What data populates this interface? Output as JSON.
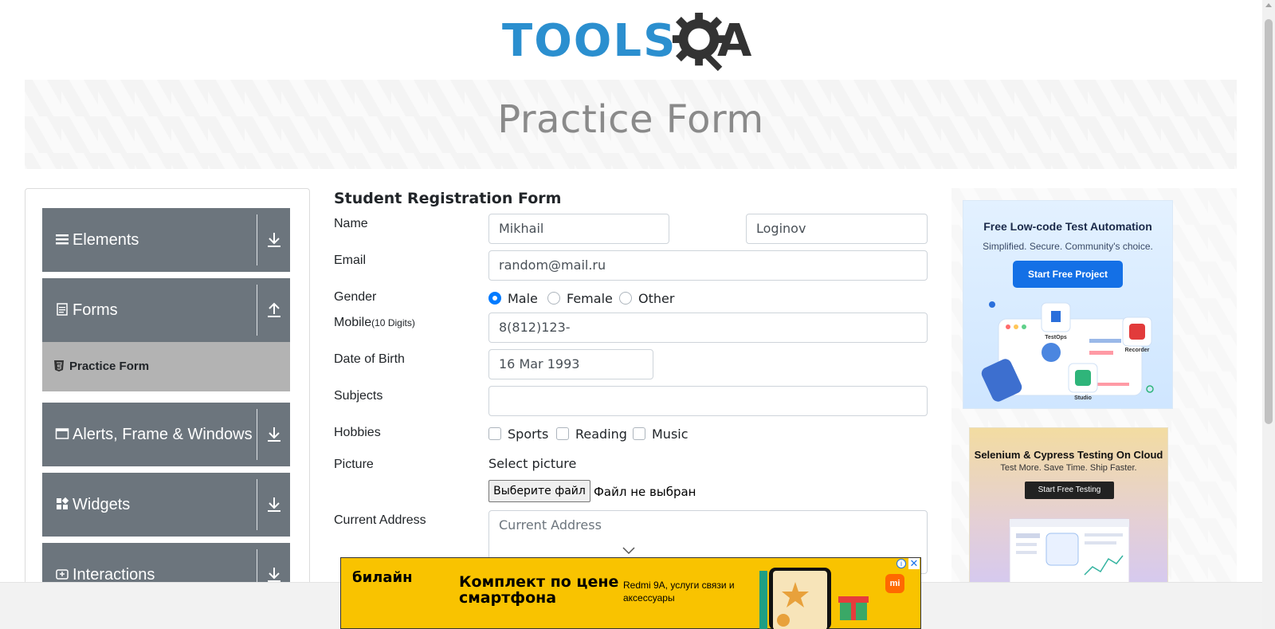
{
  "header": {
    "logo_text_tools": "TOOLS",
    "logo_text_a": "A",
    "brand_colors": {
      "tools": "#2b8fcf",
      "qa": "#333333"
    }
  },
  "banner": {
    "title": "Practice Form"
  },
  "sidebar": {
    "groups": [
      {
        "label": "Elements",
        "icon": "hamburger-icon",
        "expanded": false
      },
      {
        "label": "Forms",
        "icon": "form-icon",
        "expanded": true
      },
      {
        "label": "Alerts, Frame & Windows",
        "icon": "window-icon",
        "expanded": false
      },
      {
        "label": "Widgets",
        "icon": "widgets-icon",
        "expanded": false
      },
      {
        "label": "Interactions",
        "icon": "interactions-icon",
        "expanded": false
      }
    ],
    "active_item": {
      "label": "Practice Form",
      "icon": "html-icon"
    }
  },
  "form": {
    "title": "Student Registration Form",
    "name_label": "Name",
    "first_name": "Mikhail",
    "last_name": "Loginov",
    "email_label": "Email",
    "email": "random@mail.ru",
    "gender_label": "Gender",
    "gender_options": [
      "Male",
      "Female",
      "Other"
    ],
    "gender_selected": "Male",
    "mobile_label": "Mobile",
    "mobile_hint": "(10 Digits)",
    "mobile": "8(812)123-",
    "dob_label": "Date of Birth",
    "dob": "16 Mar 1993",
    "subjects_label": "Subjects",
    "subjects": "",
    "hobbies_label": "Hobbies",
    "hobbies": [
      "Sports",
      "Reading",
      "Music"
    ],
    "picture_label": "Picture",
    "select_picture": "Select picture",
    "file_button": "Выберите файл",
    "file_status": "Файл не выбран",
    "address_label": "Current Address",
    "address_placeholder": "Current Address"
  },
  "ads": {
    "ad1": {
      "title": "Free Low-code Test Automation",
      "subtitle": "Simplified. Secure. Community's choice.",
      "button": "Start Free Project",
      "labels": [
        "TestOps",
        "Recorder",
        "Studio"
      ]
    },
    "ad2": {
      "title": "Selenium & Cypress Testing On Cloud",
      "subtitle": "Test More. Save Time. Ship Faster.",
      "button": "Start Free Testing"
    }
  },
  "bottom_ad": {
    "brand": "билайн",
    "headline": "Комплект по цене смартфона",
    "sub": "Redmi 9A, услуги связи и аксессуары",
    "mi_logo": "mi",
    "info": "i",
    "close": "✕"
  }
}
